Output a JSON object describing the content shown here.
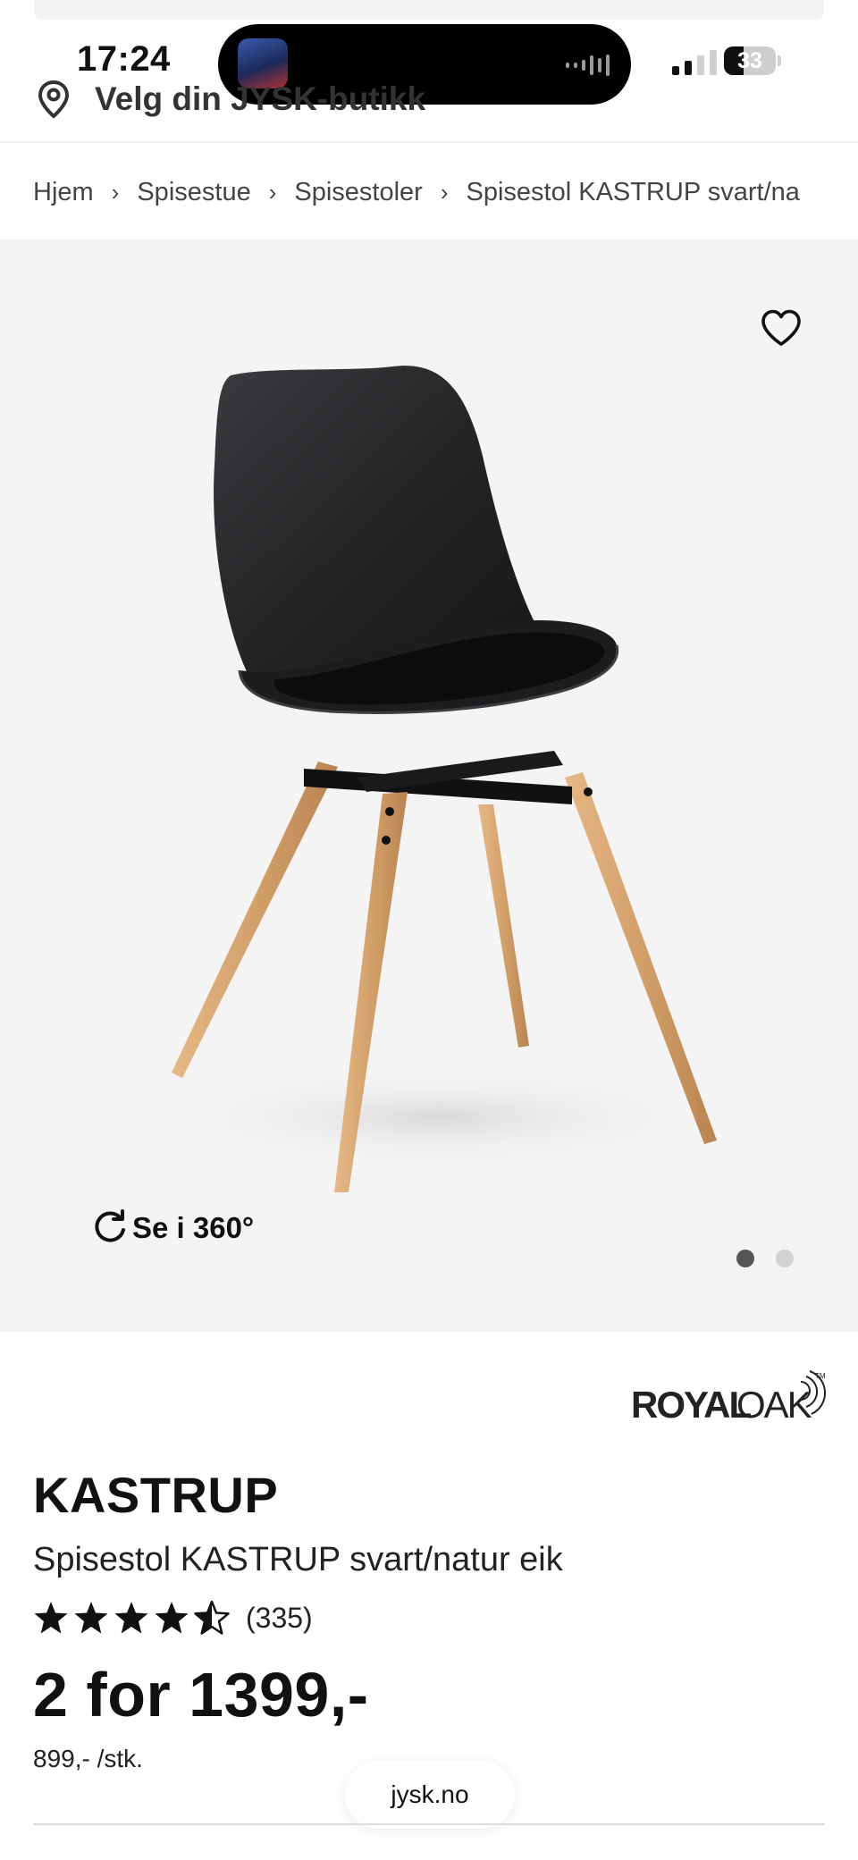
{
  "status_bar": {
    "time": "17:24",
    "battery_level": "33"
  },
  "location": {
    "label": "Velg din JYSK-butikk"
  },
  "breadcrumb": [
    {
      "label": "Hjem"
    },
    {
      "label": "Spisestue"
    },
    {
      "label": "Spisestoler"
    },
    {
      "label": "Spisestol KASTRUP svart/na"
    }
  ],
  "gallery": {
    "view_360_label": "Se i 360°",
    "slide_count": 2,
    "active_slide": 1
  },
  "product": {
    "brand_logo": "ROYAL OAK",
    "name": "KASTRUP",
    "description": "Spisestol KASTRUP svart/natur eik",
    "rating": 4.5,
    "rating_count": "(335)",
    "price": "2 for 1399,-",
    "unit_price": "899,- /stk."
  },
  "browser": {
    "url": "jysk.no"
  },
  "icons": {
    "location": "location-pin-icon",
    "favorite": "heart-icon",
    "rotate": "rotate-360-icon",
    "rating": "star-icon"
  },
  "colors": {
    "text": "#111111",
    "gallery_bg": "#f4f4f4",
    "chair_shell": "#1f2022",
    "chair_legs": "#d3a06a",
    "dot_active": "#555555",
    "dot_inactive": "#d2d2d2"
  }
}
